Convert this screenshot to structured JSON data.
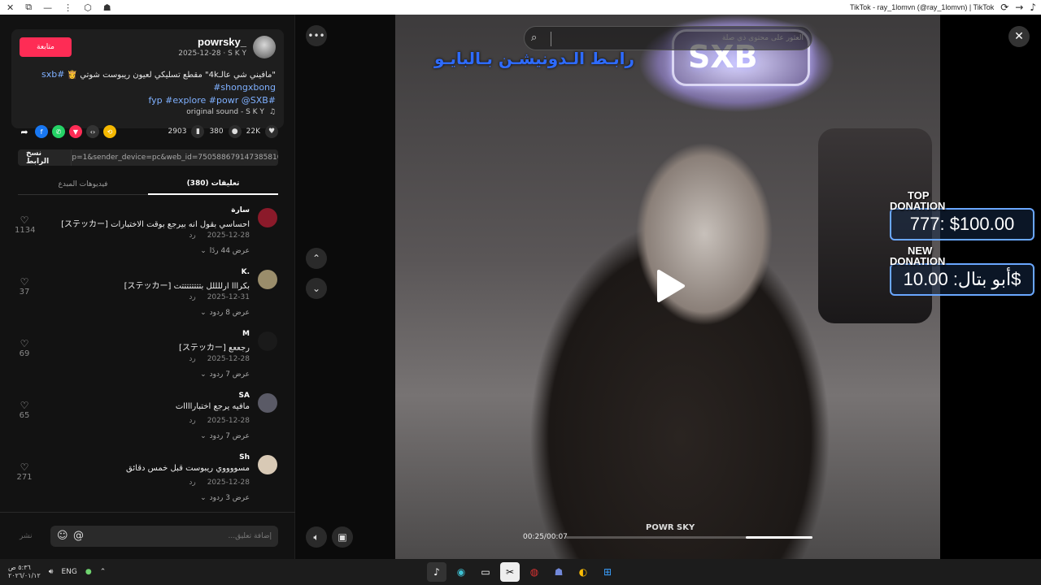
{
  "window": {
    "title": "TikTok - ray_1lomvn (@ray_1lomvn) | TikTok"
  },
  "post": {
    "follow_label": "متابعة",
    "username": "powrsky_",
    "subline": "2025-12-28 · S K Y",
    "caption_text": "\"مافيني شي عالـ4k\" مقطع تسليكي لعيون ريبوست شوتي 👸",
    "caption_tags_line1": "#sxb #shongxbong",
    "caption_tags_line2": "#fyp #explore #powr @SXB",
    "sound": "original sound - S K Y",
    "likes": "22K",
    "comments_count": "380",
    "saves": "2903",
    "copy_link_label": "نسخ الرابط",
    "link_text": "p=1&sender_device=pc&web_id=7505886791473858103..."
  },
  "tabs": {
    "comments": "(380) تعليقات",
    "creator_videos": "فيديوهات المبدع"
  },
  "comments": [
    {
      "name": "سارة",
      "text": "احساسي بقول انه بيرجع بوقت الاختبارات [ステッカー]",
      "date": "2025-12-28",
      "reply": "رد",
      "replies": "عرض 44 ردًا",
      "likes": "1134",
      "avatar": "#8b1a2a"
    },
    {
      "name": "K.",
      "text": "بكرااا ارللللل بتتتتتتتتت [ステッカー]",
      "date": "2025-12-31",
      "reply": "رد",
      "replies": "عرض 8 ردود",
      "likes": "37",
      "avatar": "#9a8d6b"
    },
    {
      "name": "M",
      "text": "رجععع [ステッカー]",
      "date": "2025-12-28",
      "reply": "رد",
      "replies": "عرض 7 ردود",
      "likes": "69",
      "avatar": "#1a1a1a"
    },
    {
      "name": "SA",
      "text": "مافيه يرجع اختباراااات",
      "date": "2025-12-28",
      "reply": "رد",
      "replies": "عرض 7 ردود",
      "likes": "65",
      "avatar": "#5a5a66"
    },
    {
      "name": "Sh",
      "text": "مسووووي ريبوست قبل خمس دقائق",
      "date": "2025-12-28",
      "reply": "رد",
      "replies": "عرض 3 ردود",
      "likes": "271",
      "avatar": "#d8c9b5"
    }
  ],
  "input": {
    "placeholder": "إضافة تعليق...",
    "post_label": "نشر"
  },
  "video": {
    "search_placeholder": "العثور على محتوى ذي صلة",
    "overlay_text": "رابـط الـدونيشـن بـالبايـو",
    "neon_text": "SXB",
    "watermark": "POWR SKY",
    "time": "00:25/00:07",
    "progress": 0.27,
    "top_donation_label_1": "TOP",
    "top_donation_label_2": "DONATION",
    "top_donation_value": "777: $100.00",
    "new_donation_label_1": "NEW",
    "new_donation_label_2": "DONATION",
    "new_donation_value": "أبو بتال: 10.00$"
  },
  "taskbar": {
    "time": "٥:٣٦ ص",
    "date": "٢٠٢٦/٠١/١٢",
    "language": "ENG"
  },
  "colors": {
    "accent": "#fe2c55",
    "donation_border": "#6aa7ff",
    "overlay_text": "#2e6bff"
  }
}
